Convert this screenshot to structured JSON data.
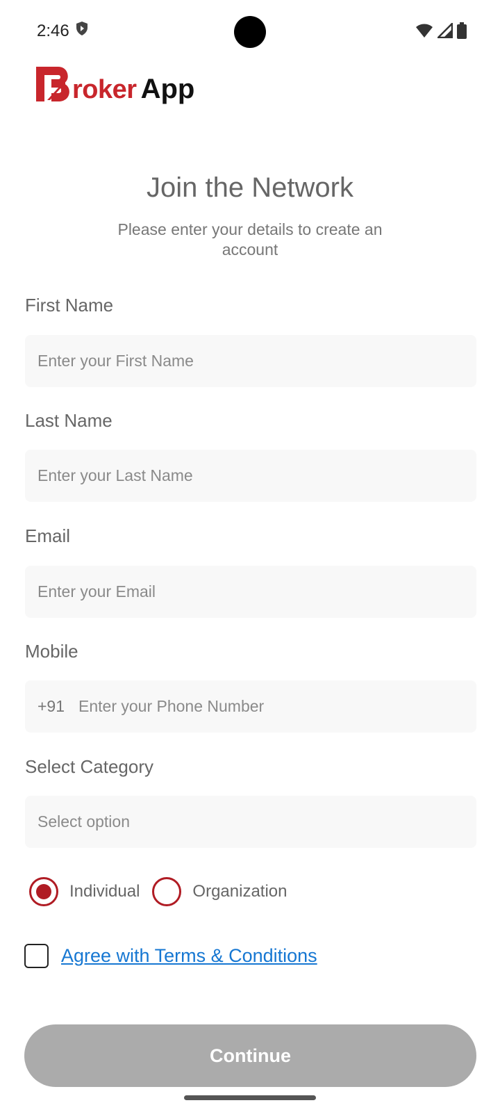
{
  "status_bar": {
    "time": "2:46",
    "icons": [
      "shield-icon",
      "wifi-icon",
      "signal-icon",
      "battery-icon"
    ]
  },
  "logo": {
    "red_text": "roker",
    "black_text": "App",
    "brand_color": "#c8262c"
  },
  "header": {
    "title": "Join the Network",
    "subtitle": "Please enter your details to create an account"
  },
  "form": {
    "first_name": {
      "label": "First Name",
      "placeholder": "Enter your First Name",
      "value": ""
    },
    "last_name": {
      "label": "Last Name",
      "placeholder": "Enter your Last Name",
      "value": ""
    },
    "email": {
      "label": "Email",
      "placeholder": "Enter your Email",
      "value": ""
    },
    "mobile": {
      "label": "Mobile",
      "prefix": "+91",
      "placeholder": "Enter your Phone Number",
      "value": ""
    },
    "category": {
      "label": "Select Category",
      "selected": "Select option"
    },
    "type_options": [
      {
        "label": "Individual",
        "selected": true
      },
      {
        "label": "Organization",
        "selected": false
      }
    ],
    "terms": {
      "label": "Agree with Terms & Conditions",
      "checked": false
    },
    "submit_label": "Continue"
  },
  "colors": {
    "accent": "#b01c24",
    "link": "#1677d2",
    "button_disabled": "#ababab"
  }
}
